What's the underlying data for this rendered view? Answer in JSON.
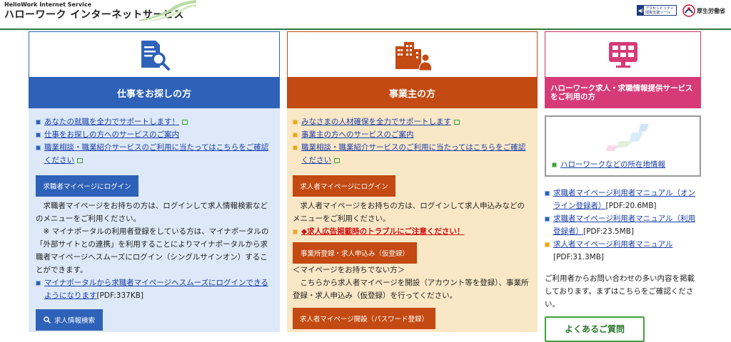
{
  "header": {
    "logo_sub": "HelloWork Internet Service",
    "logo_main": "ハローワーク インターネットサービス",
    "accessibility_badge": "アクセシビリティ閲覧支援ツール",
    "mhlw_label": "厚生労働省"
  },
  "job_seeker": {
    "title": "仕事をお探しの方",
    "links": [
      "あなたの就職を全力でサポートします！",
      "仕事をお探しの方へのサービスのご案内",
      "職業相談・職業紹介サービスのご利用に当たってはこちらをご確認ください"
    ],
    "login_button": "求職者マイページにログイン",
    "login_desc": "求職者マイページをお持ちの方は、ログインして求人情報検索などのメニューをご利用ください。",
    "mynaportal_note": "※ マイナポータルの利用者登録をしている方は、マイナポータルの「外部サイトとの連携」を利用することによりマイナポータルから求職者マイページへスムーズにログイン（シングルサインオン）することができます。",
    "mynaportal_link": "マイナポータルから求職者マイページへスムーズにログインできるようになります",
    "mynaportal_size": "[PDF:337KB]",
    "search_button": "求人情報検索"
  },
  "employer": {
    "title": "事業主の方",
    "links": [
      "みなさまの人材確保を全力でサポートします",
      "事業主の方へのサービスのご案内",
      "職業相談・職業紹介サービスのご利用に当たってはこちらをご確認ください"
    ],
    "login_button": "求人者マイページにログイン",
    "login_desc": "求人者マイページをお持ちの方は、ログインして求人申込みなどのメニューをご利用ください。",
    "warning_link": "◆求人広告掲載時のトラブルにご注意ください！",
    "register_button": "事業所登録・求人申込み（仮登録）",
    "no_mypage_heading": "＜マイページをお持ちでない方＞",
    "no_mypage_desc": "こちらから求人者マイページを開設（アカウント等を登録）、事業所登録・求人申込み（仮登録）を行ってください。",
    "open_button": "求人者マイページ開設（パスワード登録）"
  },
  "info": {
    "title": "ハローワーク求人・求職情報提供サービスをご利用の方",
    "map_link": "ハローワークなどの所在地情報",
    "manual_links": [
      {
        "text": "求職者マイページ利用者マニュアル（オンライン登録者）",
        "size": "[PDF:20.6MB]"
      },
      {
        "text": "求職者マイページ利用者マニュアル（利用登録者）",
        "size": "[PDF:23.5MB]"
      },
      {
        "text": "求人者マイページ利用者マニュアル",
        "size": "[PDF:31.3MB]"
      }
    ],
    "faq_desc": "ご利用者からお問い合わせの多い内容を掲載しております。まずはこちらをご確認ください。",
    "faq_button": "よくあるご質問"
  },
  "colors": {
    "job_blue": "#2e61b8",
    "employer_orange": "#c34a12",
    "info_pink": "#d63b78",
    "header_green": "#2c7b3f"
  }
}
